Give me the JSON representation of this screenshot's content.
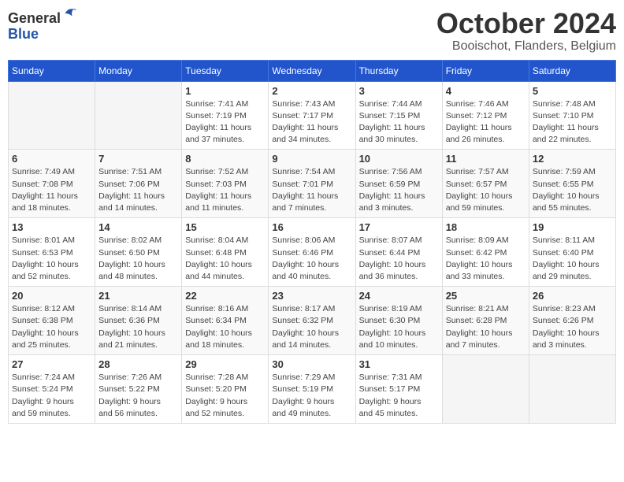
{
  "header": {
    "logo_general": "General",
    "logo_blue": "Blue",
    "month": "October 2024",
    "location": "Booischot, Flanders, Belgium"
  },
  "days_of_week": [
    "Sunday",
    "Monday",
    "Tuesday",
    "Wednesday",
    "Thursday",
    "Friday",
    "Saturday"
  ],
  "weeks": [
    [
      {
        "day": "",
        "detail": ""
      },
      {
        "day": "",
        "detail": ""
      },
      {
        "day": "1",
        "detail": "Sunrise: 7:41 AM\nSunset: 7:19 PM\nDaylight: 11 hours\nand 37 minutes."
      },
      {
        "day": "2",
        "detail": "Sunrise: 7:43 AM\nSunset: 7:17 PM\nDaylight: 11 hours\nand 34 minutes."
      },
      {
        "day": "3",
        "detail": "Sunrise: 7:44 AM\nSunset: 7:15 PM\nDaylight: 11 hours\nand 30 minutes."
      },
      {
        "day": "4",
        "detail": "Sunrise: 7:46 AM\nSunset: 7:12 PM\nDaylight: 11 hours\nand 26 minutes."
      },
      {
        "day": "5",
        "detail": "Sunrise: 7:48 AM\nSunset: 7:10 PM\nDaylight: 11 hours\nand 22 minutes."
      }
    ],
    [
      {
        "day": "6",
        "detail": "Sunrise: 7:49 AM\nSunset: 7:08 PM\nDaylight: 11 hours\nand 18 minutes."
      },
      {
        "day": "7",
        "detail": "Sunrise: 7:51 AM\nSunset: 7:06 PM\nDaylight: 11 hours\nand 14 minutes."
      },
      {
        "day": "8",
        "detail": "Sunrise: 7:52 AM\nSunset: 7:03 PM\nDaylight: 11 hours\nand 11 minutes."
      },
      {
        "day": "9",
        "detail": "Sunrise: 7:54 AM\nSunset: 7:01 PM\nDaylight: 11 hours\nand 7 minutes."
      },
      {
        "day": "10",
        "detail": "Sunrise: 7:56 AM\nSunset: 6:59 PM\nDaylight: 11 hours\nand 3 minutes."
      },
      {
        "day": "11",
        "detail": "Sunrise: 7:57 AM\nSunset: 6:57 PM\nDaylight: 10 hours\nand 59 minutes."
      },
      {
        "day": "12",
        "detail": "Sunrise: 7:59 AM\nSunset: 6:55 PM\nDaylight: 10 hours\nand 55 minutes."
      }
    ],
    [
      {
        "day": "13",
        "detail": "Sunrise: 8:01 AM\nSunset: 6:53 PM\nDaylight: 10 hours\nand 52 minutes."
      },
      {
        "day": "14",
        "detail": "Sunrise: 8:02 AM\nSunset: 6:50 PM\nDaylight: 10 hours\nand 48 minutes."
      },
      {
        "day": "15",
        "detail": "Sunrise: 8:04 AM\nSunset: 6:48 PM\nDaylight: 10 hours\nand 44 minutes."
      },
      {
        "day": "16",
        "detail": "Sunrise: 8:06 AM\nSunset: 6:46 PM\nDaylight: 10 hours\nand 40 minutes."
      },
      {
        "day": "17",
        "detail": "Sunrise: 8:07 AM\nSunset: 6:44 PM\nDaylight: 10 hours\nand 36 minutes."
      },
      {
        "day": "18",
        "detail": "Sunrise: 8:09 AM\nSunset: 6:42 PM\nDaylight: 10 hours\nand 33 minutes."
      },
      {
        "day": "19",
        "detail": "Sunrise: 8:11 AM\nSunset: 6:40 PM\nDaylight: 10 hours\nand 29 minutes."
      }
    ],
    [
      {
        "day": "20",
        "detail": "Sunrise: 8:12 AM\nSunset: 6:38 PM\nDaylight: 10 hours\nand 25 minutes."
      },
      {
        "day": "21",
        "detail": "Sunrise: 8:14 AM\nSunset: 6:36 PM\nDaylight: 10 hours\nand 21 minutes."
      },
      {
        "day": "22",
        "detail": "Sunrise: 8:16 AM\nSunset: 6:34 PM\nDaylight: 10 hours\nand 18 minutes."
      },
      {
        "day": "23",
        "detail": "Sunrise: 8:17 AM\nSunset: 6:32 PM\nDaylight: 10 hours\nand 14 minutes."
      },
      {
        "day": "24",
        "detail": "Sunrise: 8:19 AM\nSunset: 6:30 PM\nDaylight: 10 hours\nand 10 minutes."
      },
      {
        "day": "25",
        "detail": "Sunrise: 8:21 AM\nSunset: 6:28 PM\nDaylight: 10 hours\nand 7 minutes."
      },
      {
        "day": "26",
        "detail": "Sunrise: 8:23 AM\nSunset: 6:26 PM\nDaylight: 10 hours\nand 3 minutes."
      }
    ],
    [
      {
        "day": "27",
        "detail": "Sunrise: 7:24 AM\nSunset: 5:24 PM\nDaylight: 9 hours\nand 59 minutes."
      },
      {
        "day": "28",
        "detail": "Sunrise: 7:26 AM\nSunset: 5:22 PM\nDaylight: 9 hours\nand 56 minutes."
      },
      {
        "day": "29",
        "detail": "Sunrise: 7:28 AM\nSunset: 5:20 PM\nDaylight: 9 hours\nand 52 minutes."
      },
      {
        "day": "30",
        "detail": "Sunrise: 7:29 AM\nSunset: 5:19 PM\nDaylight: 9 hours\nand 49 minutes."
      },
      {
        "day": "31",
        "detail": "Sunrise: 7:31 AM\nSunset: 5:17 PM\nDaylight: 9 hours\nand 45 minutes."
      },
      {
        "day": "",
        "detail": ""
      },
      {
        "day": "",
        "detail": ""
      }
    ]
  ]
}
